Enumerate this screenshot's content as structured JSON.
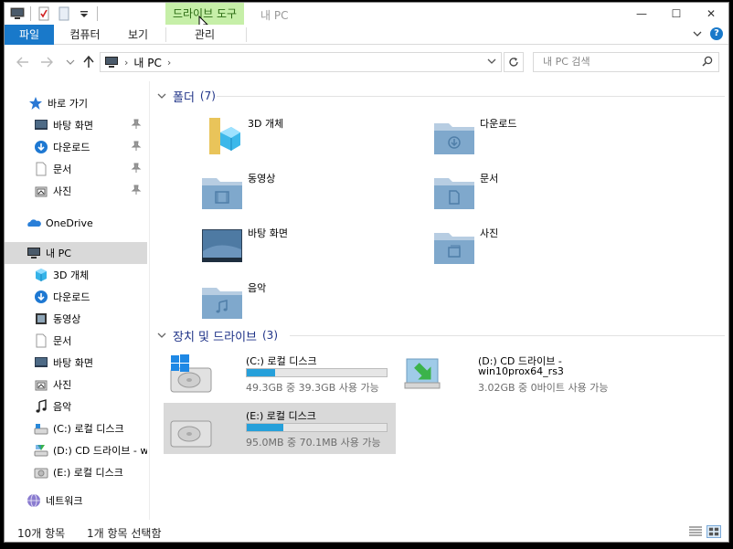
{
  "titlebar": {
    "context_tab": "드라이브 도구",
    "title": "내 PC",
    "minimize": "—",
    "maximize": "☐",
    "close": "✕"
  },
  "ribbon": {
    "tabs": [
      {
        "label": "파일"
      },
      {
        "label": "컴퓨터"
      },
      {
        "label": "보기"
      },
      {
        "label": "관리"
      }
    ]
  },
  "address": {
    "crumb": "내 PC",
    "search_placeholder": "내 PC 검색"
  },
  "nav": {
    "quick_access": "바로 가기",
    "quick_items": [
      {
        "label": "바탕 화면",
        "icon": "desktop-icon"
      },
      {
        "label": "다운로드",
        "icon": "download-icon"
      },
      {
        "label": "문서",
        "icon": "document-icon"
      },
      {
        "label": "사진",
        "icon": "pictures-icon"
      }
    ],
    "onedrive": "OneDrive",
    "this_pc": "내 PC",
    "pc_items": [
      {
        "label": "3D 개체",
        "icon": "3d-objects-icon"
      },
      {
        "label": "다운로드",
        "icon": "download-icon"
      },
      {
        "label": "동영상",
        "icon": "video-icon"
      },
      {
        "label": "문서",
        "icon": "document-icon"
      },
      {
        "label": "바탕 화면",
        "icon": "desktop-icon"
      },
      {
        "label": "사진",
        "icon": "pictures-icon"
      },
      {
        "label": "음악",
        "icon": "music-icon"
      },
      {
        "label": "(C:) 로컬 디스크",
        "icon": "local-disk-icon"
      },
      {
        "label": "(D:) CD 드라이브 - w",
        "icon": "cd-drive-icon"
      },
      {
        "label": "(E:) 로컬 디스크",
        "icon": "local-disk-icon"
      }
    ],
    "network": "네트워크"
  },
  "folders_group": {
    "title": "폴더",
    "count": "(7)",
    "items": [
      {
        "label": "3D 개체",
        "icon": "3d-objects-folder-icon"
      },
      {
        "label": "다운로드",
        "icon": "download-folder-icon"
      },
      {
        "label": "동영상",
        "icon": "video-folder-icon"
      },
      {
        "label": "문서",
        "icon": "document-folder-icon"
      },
      {
        "label": "바탕 화면",
        "icon": "desktop-folder-icon"
      },
      {
        "label": "사진",
        "icon": "pictures-folder-icon"
      },
      {
        "label": "음악",
        "icon": "music-folder-icon"
      }
    ]
  },
  "drives_group": {
    "title": "장치 및 드라이브",
    "count": "(3)",
    "drives": [
      {
        "name": "(C:) 로컬 디스크",
        "free": "49.3GB 중 39.3GB 사용 가능",
        "used_fraction": 0.2,
        "icon": "windows-hard-disk-icon"
      },
      {
        "name_line1": "(D:) CD 드라이브 -",
        "name_line2": "win10prox64_rs3",
        "free": "3.02GB 중 0바이트 사용 가능",
        "icon": "cd-drive-icon"
      },
      {
        "name": "(E:) 로컬 디스크",
        "free": "95.0MB 중 70.1MB 사용 가능",
        "used_fraction": 0.26,
        "icon": "hard-disk-icon"
      }
    ]
  },
  "status": {
    "items": "10개 항목",
    "selected": "1개 항목 선택함"
  }
}
